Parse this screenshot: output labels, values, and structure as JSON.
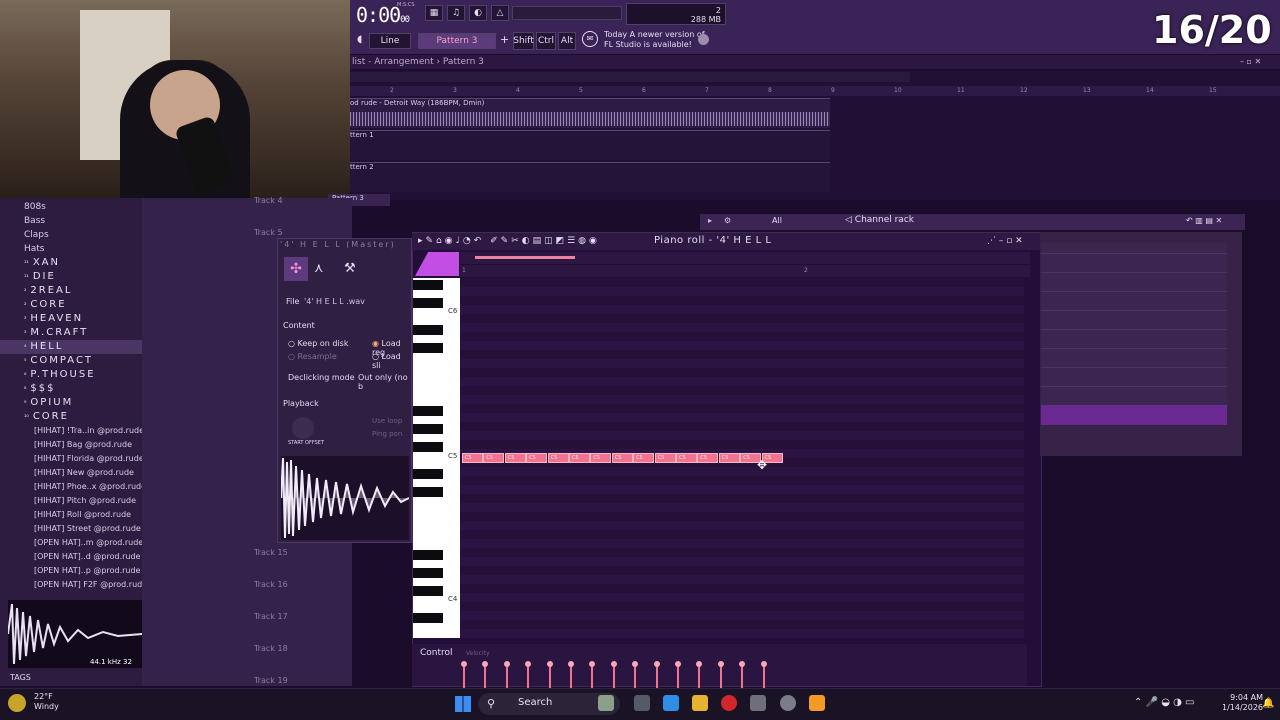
{
  "counter": "16/20",
  "toolbar": {
    "time_main": "0:00",
    "time_small": "00",
    "time_unit": "M:S:CS",
    "snap": "Line",
    "pattern": "Pattern 3",
    "shift": "Shift",
    "ctrl": "Ctrl",
    "alt": "Alt",
    "mem_top": "2",
    "mem_value": "288 MB",
    "mem_bottom": "0",
    "notice_line1": "Today  A newer version of",
    "notice_line2": "FL Studio is available!"
  },
  "playlist": {
    "breadcrumb": "list - Arrangement  ›  Pattern 3",
    "ruler": [
      "2",
      "3",
      "4",
      "5",
      "6",
      "7",
      "8",
      "9",
      "10",
      "11",
      "12",
      "13",
      "14",
      "15"
    ],
    "tracks": [
      {
        "label": "od rude - Detroit Way (186BPM, Dmin)"
      },
      {
        "label": "ttern 1"
      },
      {
        "label": "ttern 2"
      }
    ],
    "track4_pattern": "Pattern 3"
  },
  "browser": {
    "folders": [
      "808s",
      "Bass",
      "Claps",
      "Hats"
    ],
    "wide_items": [
      {
        "num": "¹¹",
        "name": "XAN"
      },
      {
        "num": "¹¹",
        "name": "DIE"
      },
      {
        "num": "²",
        "name": "2REAL"
      },
      {
        "num": "²",
        "name": "CORE"
      },
      {
        "num": "³",
        "name": "HEAVEN"
      },
      {
        "num": "³",
        "name": "M.CRAFT"
      },
      {
        "num": "⁴",
        "name": "HELL"
      },
      {
        "num": "⁵",
        "name": "COMPACT"
      },
      {
        "num": "⁶",
        "name": "P.THOUSE"
      },
      {
        "num": "⁸",
        "name": "$$$"
      },
      {
        "num": "⁹",
        "name": "OPIUM"
      },
      {
        "num": "¹⁰",
        "name": "CORE"
      }
    ],
    "samples": [
      "[HIHAT] !Tra..in @prod.rude",
      "[HIHAT] Bag @prod.rude",
      "[HIHAT] Florida @prod.rude",
      "[HIHAT] New @prod.rude",
      "[HIHAT] Phoe..x @prod.rude",
      "[HIHAT] Pitch @prod.rude",
      "[HIHAT] Roll @prod.rude",
      "[HIHAT] Street @prod.rude",
      "[OPEN HAT]..m @prod.rude",
      "[OPEN HAT]..d @prod.rude",
      "[OPEN HAT]..p @prod.rude",
      "[OPEN HAT] F2F @prod.rude"
    ],
    "preview_info": "44.1 kHz 32",
    "tags": "TAGS"
  },
  "tracks": [
    {
      "label": "Track 4"
    },
    {
      "label": "Track 5"
    },
    {
      "label": "Track 15"
    },
    {
      "label": "Track 16"
    },
    {
      "label": "Track 17"
    },
    {
      "label": "Track 18"
    },
    {
      "label": "Track 19"
    }
  ],
  "channel": {
    "title": "'4' H E L L  (Master)",
    "file_label": "File",
    "file_name": "'4' H E L L .wav",
    "content": "Content",
    "keep_on_disk": "Keep on disk",
    "resample": "Resample",
    "load_reg": "Load reg",
    "load_sli": "Load sli",
    "declicking": "Declicking mode",
    "declick_value": "Out only (no b",
    "playback": "Playback",
    "use_loop": "Use loop",
    "ping_pong": "Ping pon",
    "start_offset": "START OFFSET"
  },
  "piano_roll": {
    "title": "Piano roll - '4' H E L L",
    "ruler": [
      "1",
      "2"
    ],
    "octaves": [
      "C6",
      "C5",
      "C4"
    ],
    "note_label": "C5",
    "note_count": 15,
    "control": "Control",
    "velocity": "Velocity"
  },
  "channel_rack": {
    "filter": "All",
    "title": "Channel rack"
  },
  "taskbar": {
    "temp": "22°F",
    "weather": "Windy",
    "search": "Search",
    "time": "9:04 AM",
    "date": "1/14/2026"
  }
}
